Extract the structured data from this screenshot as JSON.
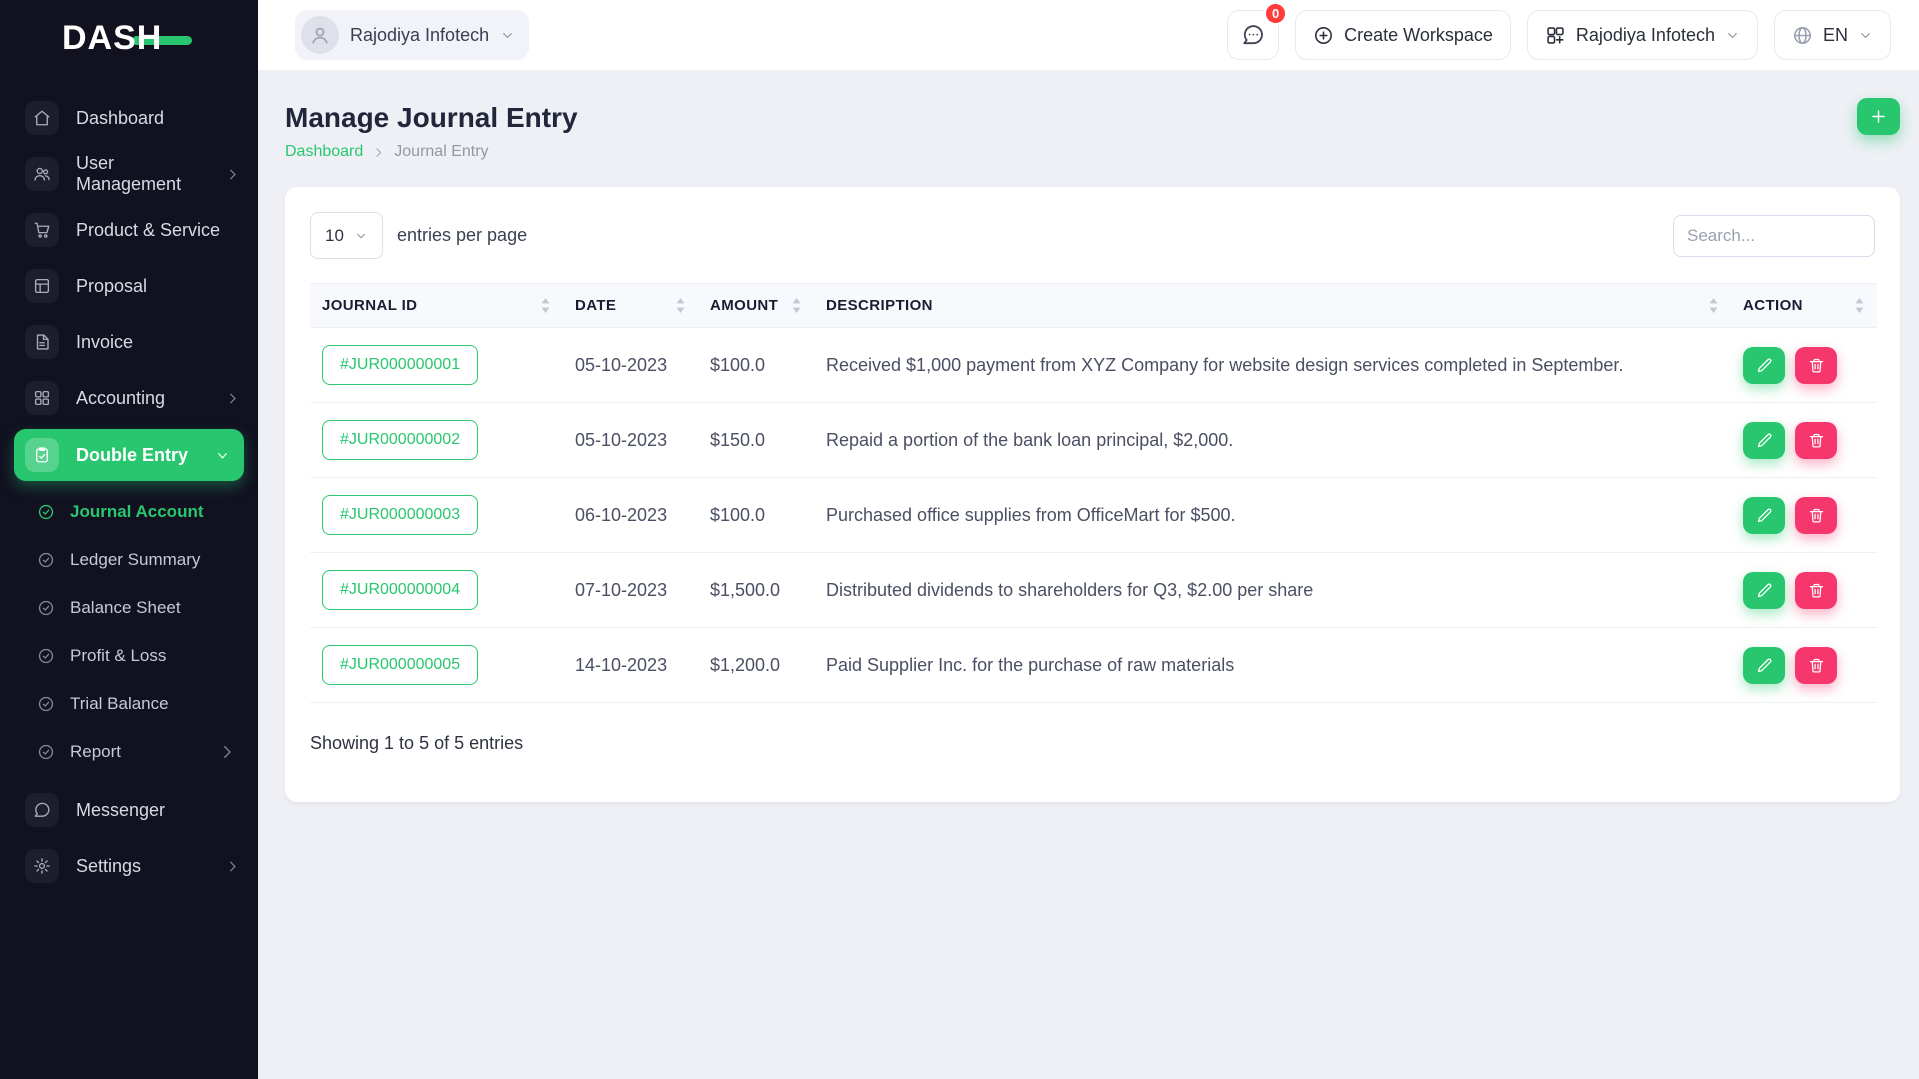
{
  "brand": {
    "logo_text": "DASH"
  },
  "header": {
    "company": "Rajodiya Infotech",
    "badge": "0",
    "create_workspace": "Create Workspace",
    "workspace": "Rajodiya Infotech",
    "language": "EN"
  },
  "sidebar": {
    "items": [
      {
        "label": "Dashboard"
      },
      {
        "label": "User Management"
      },
      {
        "label": "Product & Service"
      },
      {
        "label": "Proposal"
      },
      {
        "label": "Invoice"
      },
      {
        "label": "Accounting"
      },
      {
        "label": "Double Entry"
      },
      {
        "label": "Messenger"
      },
      {
        "label": "Settings"
      }
    ],
    "submenu": [
      {
        "label": "Journal Account"
      },
      {
        "label": "Ledger Summary"
      },
      {
        "label": "Balance Sheet"
      },
      {
        "label": "Profit & Loss"
      },
      {
        "label": "Trial Balance"
      },
      {
        "label": "Report"
      }
    ]
  },
  "page": {
    "title": "Manage Journal Entry",
    "breadcrumb_root": "Dashboard",
    "breadcrumb_current": "Journal Entry"
  },
  "card": {
    "per_page_value": "10",
    "per_page_label": "entries per page",
    "search_placeholder": "Search...",
    "columns": [
      "JOURNAL ID",
      "DATE",
      "AMOUNT",
      "DESCRIPTION",
      "ACTION"
    ],
    "rows": [
      {
        "journal_id": "#JUR000000001",
        "date": "05-10-2023",
        "amount": "$100.0",
        "description": "Received $1,000 payment from XYZ Company for website design services completed in September."
      },
      {
        "journal_id": "#JUR000000002",
        "date": "05-10-2023",
        "amount": "$150.0",
        "description": "Repaid a portion of the bank loan principal, $2,000."
      },
      {
        "journal_id": "#JUR000000003",
        "date": "06-10-2023",
        "amount": "$100.0",
        "description": "Purchased office supplies from OfficeMart for $500."
      },
      {
        "journal_id": "#JUR000000004",
        "date": "07-10-2023",
        "amount": "$1,500.0",
        "description": "Distributed dividends to shareholders for Q3, $2.00 per share"
      },
      {
        "journal_id": "#JUR000000005",
        "date": "14-10-2023",
        "amount": "$1,200.0",
        "description": "Paid Supplier Inc. for the purchase of raw materials"
      }
    ],
    "footer": "Showing 1 to 5 of 5 entries"
  },
  "colors": {
    "accent_green": "#28c76f",
    "danger_pink": "#f5376e",
    "badge_red": "#ff3b3b",
    "sidebar_dark": "#111120"
  }
}
